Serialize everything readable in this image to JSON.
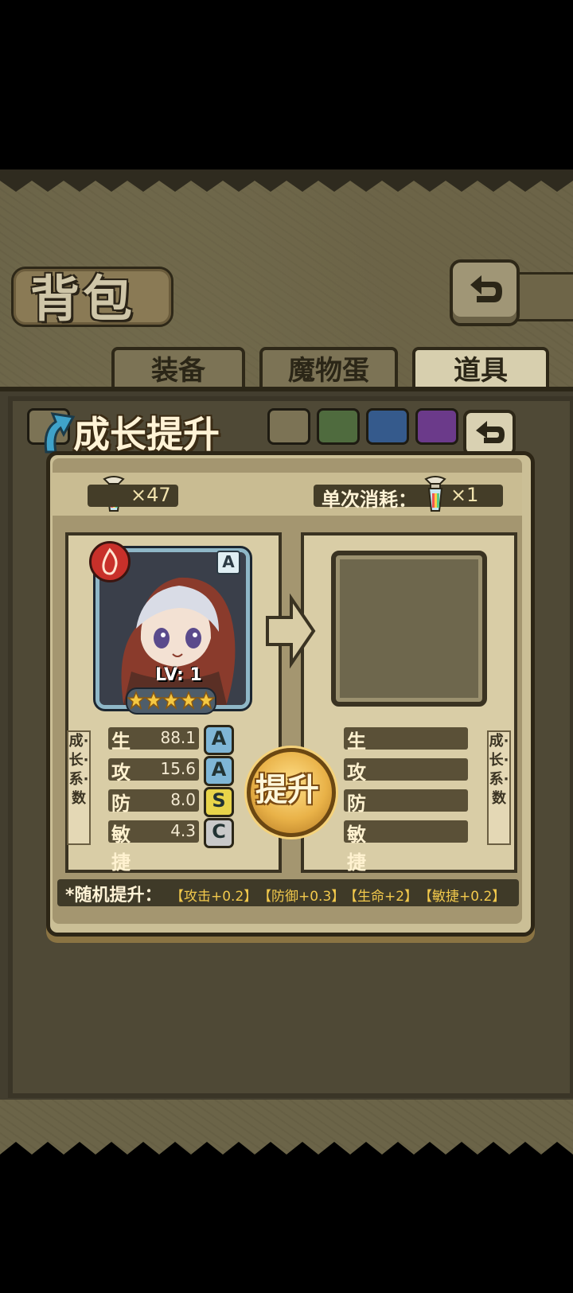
{
  "header": {
    "title": "背包"
  },
  "tabs": [
    {
      "label": "装备",
      "active": false
    },
    {
      "label": "魔物蛋",
      "active": false
    },
    {
      "label": "道具",
      "active": true
    }
  ],
  "dialog": {
    "title": "成长提升",
    "item_count": "×47",
    "cost_label": "单次消耗：",
    "cost_value": "×1",
    "card": {
      "level": "LV: 1",
      "rank": "A",
      "stars": 5,
      "element": "fire"
    },
    "stats_current": [
      {
        "name": "生命",
        "value": "88.1",
        "grade": "A"
      },
      {
        "name": "攻击",
        "value": "15.6",
        "grade": "A"
      },
      {
        "name": "防御",
        "value": "8.0",
        "grade": "S"
      },
      {
        "name": "敏捷",
        "value": "4.3",
        "grade": "C"
      }
    ],
    "stats_result": [
      {
        "name": "生命"
      },
      {
        "name": "攻击"
      },
      {
        "name": "防御"
      },
      {
        "name": "敏捷"
      }
    ],
    "side_label": "成·长·系·数",
    "upgrade_button": "提升",
    "random_label": "*随机提升：",
    "random_options": [
      "【攻击+0.2】",
      "【防御+0.3】",
      "【生命+2】",
      "【敏捷+0.2】"
    ]
  },
  "colors": {
    "accent_gold": "#f2c94c",
    "grade_A": "#7fb6d6",
    "grade_S": "#e8d44a",
    "grade_C": "#c9c9c9",
    "filter_chips": [
      "#7c7355",
      "#7c7355",
      "#4f6b3e",
      "#355a8c",
      "#6b3a8a"
    ]
  }
}
